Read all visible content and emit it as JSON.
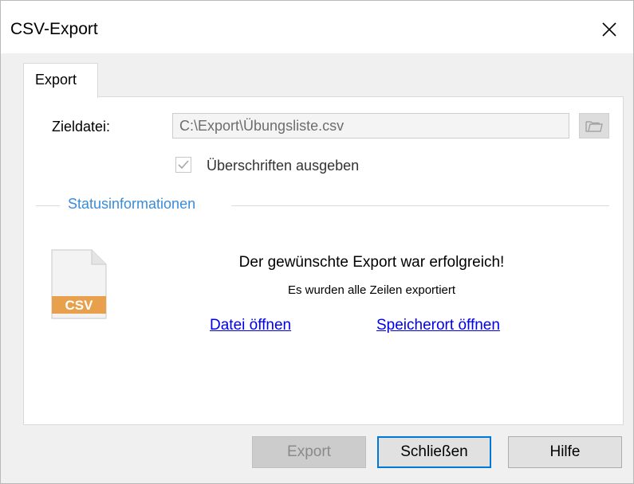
{
  "window": {
    "title": "CSV-Export",
    "close_icon": "close-icon"
  },
  "tabs": [
    {
      "label": "Export",
      "active": true
    }
  ],
  "target_file": {
    "label": "Zieldatei:",
    "value": "C:\\Export\\Übungsliste.csv",
    "browse_icon": "folder-icon",
    "enabled": false
  },
  "headers_option": {
    "label": "Überschriften ausgeben",
    "checked": true,
    "enabled": false
  },
  "status_group": {
    "title": "Statusinformationen",
    "file_icon_label": "CSV",
    "message": "Der gewünschte Export war erfolgreich!",
    "detail": "Es wurden alle Zeilen exportiert",
    "open_file_link": "Datei öffnen",
    "open_location_link": "Speicherort öffnen"
  },
  "buttons": {
    "export": "Export",
    "close": "Schließen",
    "help": "Hilfe"
  },
  "colors": {
    "accent": "#0078d7",
    "group_title": "#3b8bd7",
    "link": "#0000ee",
    "csv_badge": "#e8a04c"
  }
}
